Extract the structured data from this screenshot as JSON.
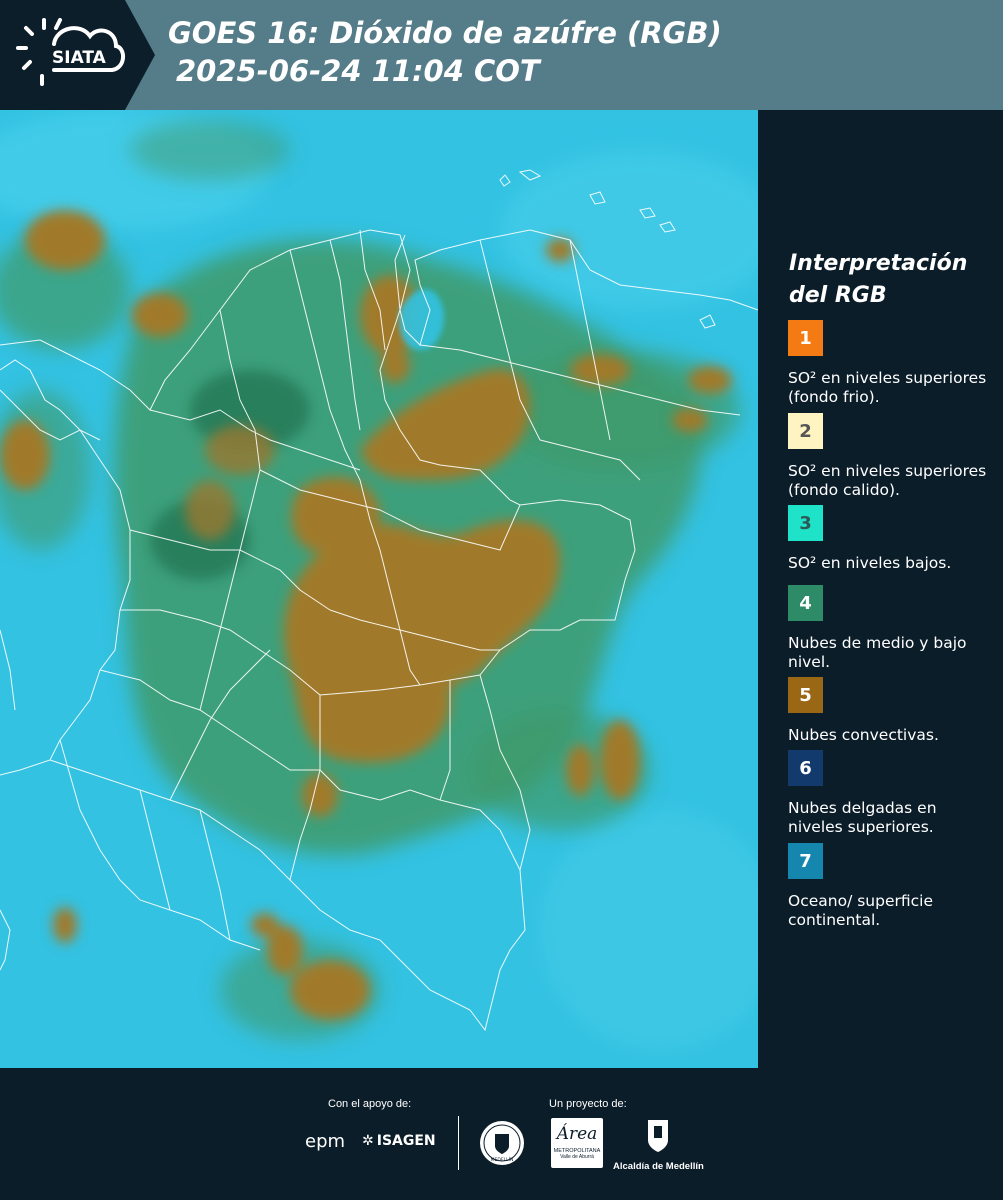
{
  "header": {
    "logo_text": "SIATA",
    "title_line1": "GOES 16: Dióxido de azúfre (RGB)",
    "title_line2": "2025-06-24 11:04 COT"
  },
  "legend": {
    "title": "Interpretación del RGB",
    "items": [
      {
        "number": "1",
        "label": "SO² en niveles superiores (fondo frio).",
        "color": "#f47b14",
        "num_color": "#ffffff"
      },
      {
        "number": "2",
        "label": "SO² en niveles superiores (fondo calido).",
        "color": "#fdf4c1",
        "num_color": "#555555"
      },
      {
        "number": "3",
        "label": "SO² en niveles bajos.",
        "color": "#1ee3c8",
        "num_color": "#2b5a57"
      },
      {
        "number": "4",
        "label": "Nubes de medio y bajo nivel.",
        "color": "#2e8b68",
        "num_color": "#ffffff"
      },
      {
        "number": "5",
        "label": "Nubes convectivas.",
        "color": "#9a6715",
        "num_color": "#ffffff"
      },
      {
        "number": "6",
        "label": "Nubes delgadas en niveles superiores.",
        "color": "#123a6c",
        "num_color": "#ffffff"
      },
      {
        "number": "7",
        "label": "Oceano/ superficie continental.",
        "color": "#1586ad",
        "num_color": "#ffffff"
      }
    ]
  },
  "map_colors": {
    "background": "#33c2e2",
    "convective": "#a07a2a",
    "mid_low": "#3f9a6a",
    "borders": "#ffffff"
  },
  "footer": {
    "support_label": "Con el apoyo de:",
    "project_label": "Un proyecto de:",
    "epm": "epm",
    "isagen": "ISAGEN",
    "medellin_seal": "MEDELLÍN",
    "area_logo": "Área",
    "area_sub1": "METROPOLITANA",
    "area_sub2": "Valle de Aburrá",
    "alcaldia": "Alcaldía de Medellín"
  }
}
